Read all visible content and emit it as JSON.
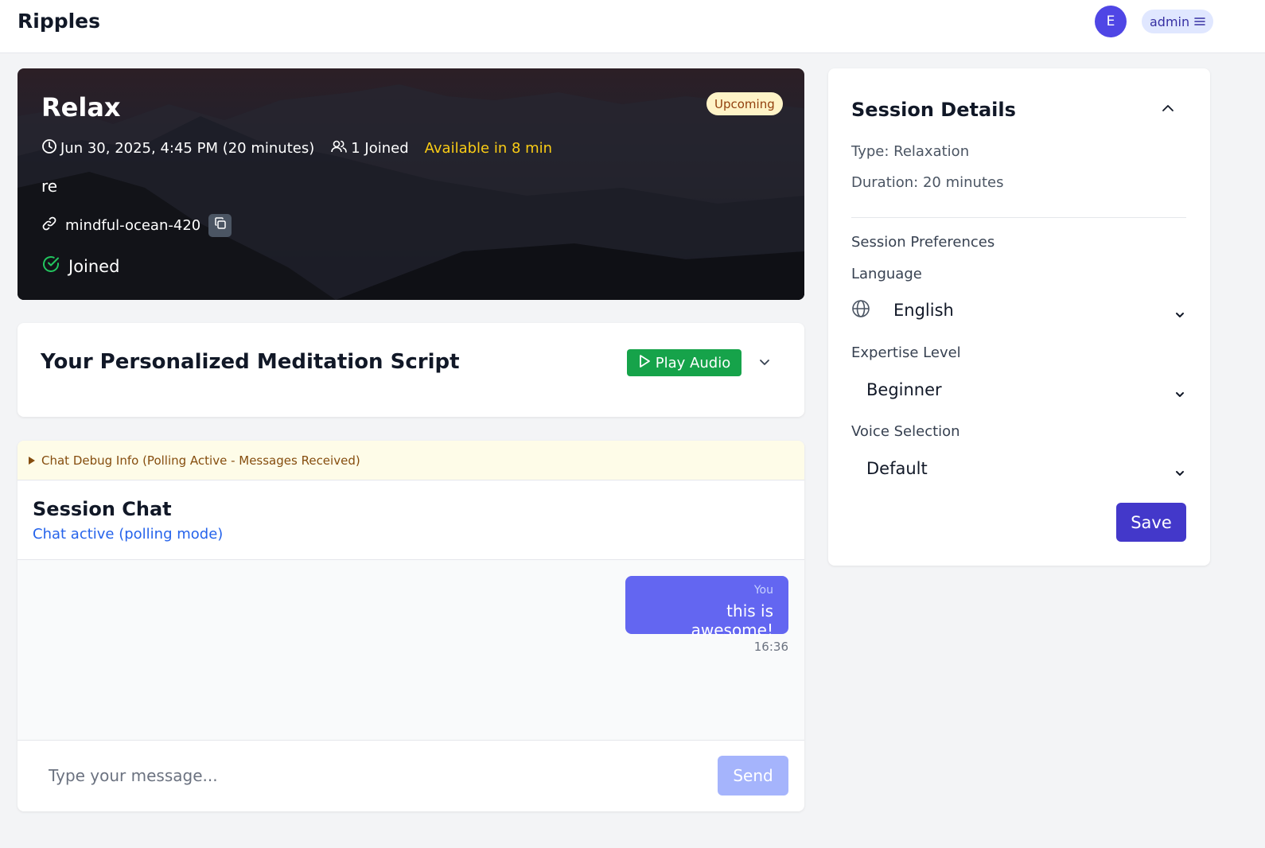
{
  "app": {
    "brand": "Ripples"
  },
  "user": {
    "avatar_initial": "E",
    "name": "admin"
  },
  "session": {
    "title": "Relax",
    "status_badge": "Upcoming",
    "datetime": "Jun 30, 2025, 4:45 PM (20 minutes)",
    "joined_count": "1 Joined",
    "availability": "Available in 8 min",
    "description": "re",
    "room_code": "mindful-ocean-420",
    "joined_label": "Joined"
  },
  "script": {
    "title": "Your Personalized Meditation Script",
    "play_label": "Play Audio"
  },
  "chat": {
    "debug_label": "Chat Debug Info (Polling Active - Messages Received)",
    "title": "Session Chat",
    "status": "Chat active (polling mode)",
    "messages": [
      {
        "sender": "You",
        "text": "this is awesome!",
        "time": "16:36"
      }
    ],
    "input_placeholder": "Type your message...",
    "send_label": "Send"
  },
  "details": {
    "title": "Session Details",
    "type_line": "Type: Relaxation",
    "duration_line": "Duration: 20 minutes",
    "preferences_heading": "Session Preferences",
    "language_label": "Language",
    "language_value": "English",
    "expertise_label": "Expertise Level",
    "expertise_value": "Beginner",
    "voice_label": "Voice Selection",
    "voice_value": "Default",
    "save_label": "Save"
  },
  "colors": {
    "accent": "#4f46e5",
    "play": "#16a34a",
    "bubble": "#6366f1",
    "availability": "#facc15",
    "joined_check": "#22c55e"
  }
}
